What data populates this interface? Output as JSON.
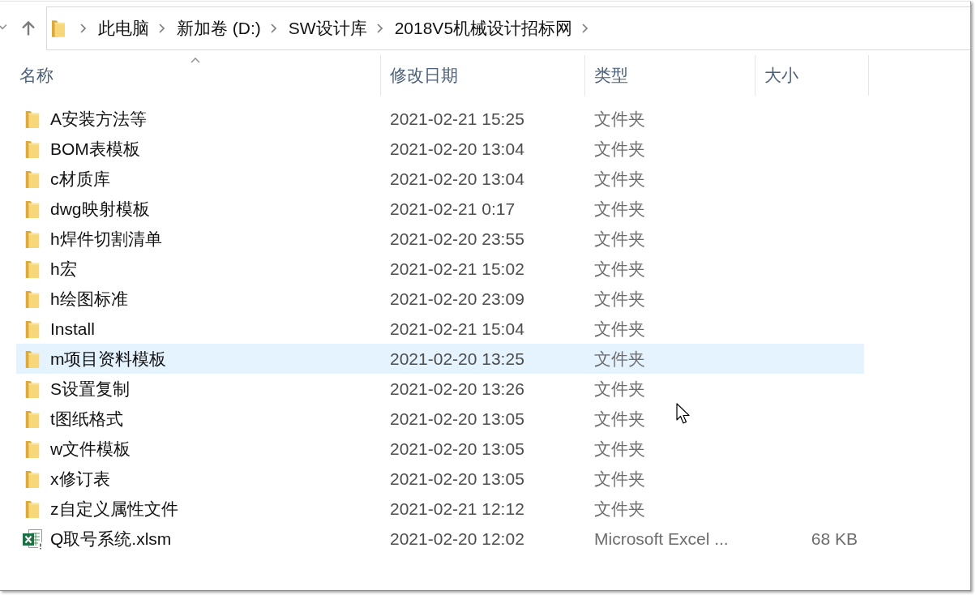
{
  "navigation": {
    "breadcrumbs": [
      "此电脑",
      "新加卷 (D:)",
      "SW设计库",
      "2018V5机械设计招标网"
    ]
  },
  "columns": [
    {
      "label": "名称",
      "sorted": true
    },
    {
      "label": "修改日期",
      "sorted": false
    },
    {
      "label": "类型",
      "sorted": false
    },
    {
      "label": "大小",
      "sorted": false
    }
  ],
  "rows": [
    {
      "kind": "folder",
      "name": "A安装方法等",
      "modified": "2021-02-21 15:25",
      "type": "文件夹",
      "hovered": false
    },
    {
      "kind": "folder",
      "name": "BOM表模板",
      "modified": "2021-02-20 13:04",
      "type": "文件夹",
      "hovered": false
    },
    {
      "kind": "folder",
      "name": "c材质库",
      "modified": "2021-02-20 13:04",
      "type": "文件夹",
      "hovered": false
    },
    {
      "kind": "folder",
      "name": "dwg映射模板",
      "modified": "2021-02-21 0:17",
      "type": "文件夹",
      "hovered": false
    },
    {
      "kind": "folder",
      "name": "h焊件切割清单",
      "modified": "2021-02-20 23:55",
      "type": "文件夹",
      "hovered": false
    },
    {
      "kind": "folder",
      "name": "h宏",
      "modified": "2021-02-21 15:02",
      "type": "文件夹",
      "hovered": false
    },
    {
      "kind": "folder",
      "name": "h绘图标准",
      "modified": "2021-02-20 23:09",
      "type": "文件夹",
      "hovered": false
    },
    {
      "kind": "folder",
      "name": "Install",
      "modified": "2021-02-21 15:04",
      "type": "文件夹",
      "hovered": false
    },
    {
      "kind": "folder",
      "name": "m项目资料模板",
      "modified": "2021-02-20 13:25",
      "type": "文件夹",
      "hovered": true
    },
    {
      "kind": "folder",
      "name": "S设置复制",
      "modified": "2021-02-20 13:26",
      "type": "文件夹",
      "hovered": false
    },
    {
      "kind": "folder",
      "name": "t图纸格式",
      "modified": "2021-02-20 13:05",
      "type": "文件夹",
      "hovered": false
    },
    {
      "kind": "folder",
      "name": "w文件模板",
      "modified": "2021-02-20 13:05",
      "type": "文件夹",
      "hovered": false
    },
    {
      "kind": "folder",
      "name": "x修订表",
      "modified": "2021-02-20 13:05",
      "type": "文件夹",
      "hovered": false
    },
    {
      "kind": "folder",
      "name": "z自定义属性文件",
      "modified": "2021-02-21 12:12",
      "type": "文件夹",
      "hovered": false
    },
    {
      "kind": "excel",
      "name": "Q取号系统.xlsm",
      "modified": "2021-02-20 12:02",
      "type": "Microsoft Excel ...",
      "size": "68 KB",
      "hovered": false
    }
  ]
}
